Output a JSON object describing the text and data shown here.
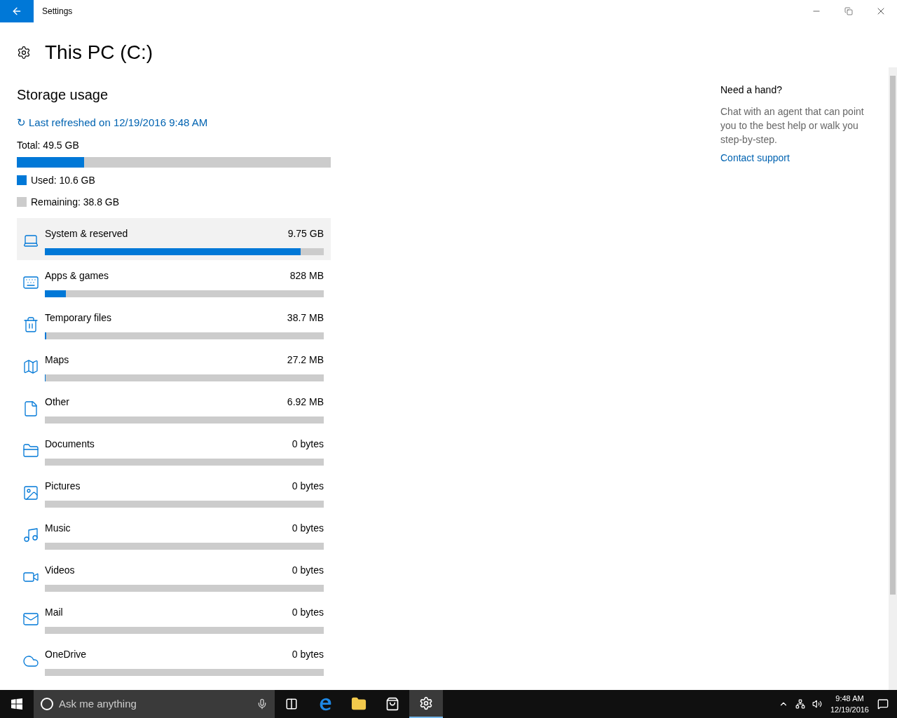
{
  "window": {
    "title": "Settings"
  },
  "page": {
    "title": "This PC (C:)"
  },
  "storage": {
    "heading": "Storage usage",
    "refresh_icon": "↻",
    "refreshed": "Last refreshed on 12/19/2016 9:48 AM",
    "total": "Total: 49.5 GB",
    "level": 0.214,
    "used": "Used: 10.6 GB",
    "remaining": "Remaining: 38.8 GB"
  },
  "categories": [
    {
      "kind": "system",
      "name": "System & reserved",
      "size": "9.75 GB",
      "level": 0.918,
      "highlighted": true
    },
    {
      "kind": "apps",
      "name": "Apps & games",
      "size": "828 MB",
      "level": 0.075,
      "highlighted": false
    },
    {
      "kind": "temp",
      "name": "Temporary files",
      "size": "38.7 MB",
      "level": 0.004,
      "highlighted": false
    },
    {
      "kind": "maps",
      "name": "Maps",
      "size": "27.2 MB",
      "level": 0.003,
      "highlighted": false
    },
    {
      "kind": "other",
      "name": "Other",
      "size": "6.92 MB",
      "highlighted": false
    },
    {
      "kind": "documents",
      "name": "Documents",
      "size": "0 bytes",
      "highlighted": false
    },
    {
      "kind": "pictures",
      "name": "Pictures",
      "size": "0 bytes",
      "highlighted": false
    },
    {
      "kind": "music",
      "name": "Music",
      "size": "0 bytes",
      "highlighted": false
    },
    {
      "kind": "videos",
      "name": "Videos",
      "size": "0 bytes",
      "highlighted": false
    },
    {
      "kind": "mail",
      "name": "Mail",
      "size": "0 bytes",
      "highlighted": false
    },
    {
      "kind": "onedrive",
      "name": "OneDrive",
      "size": "0 bytes",
      "highlighted": false
    }
  ],
  "help": {
    "heading": "Need a hand?",
    "text": "Chat with an agent that can point you to the best help or walk you step-by-step.",
    "link": "Contact support"
  },
  "taskbar": {
    "search_placeholder": "Ask me anything",
    "time": "9:48 AM",
    "date": "12/19/2016"
  }
}
